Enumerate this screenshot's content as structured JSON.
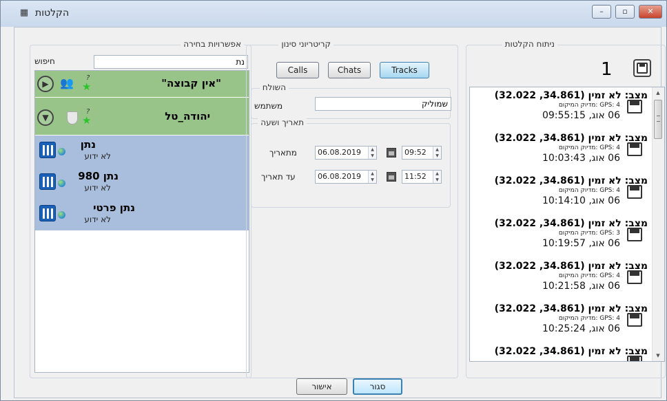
{
  "window": {
    "title": "הקלטות"
  },
  "options_panel": {
    "title": "אפשרויות בחירה",
    "search_label": "חיפוש",
    "search_value": "נת",
    "items": [
      {
        "name": "\"אין קבוצה\"",
        "kind": "group",
        "expand_icon": "play-circle-icon"
      },
      {
        "name": "יהודה_טל",
        "kind": "group",
        "expand_icon": "chevron-down-circle-icon"
      },
      {
        "name": "נתן",
        "status": "לא ידוע",
        "kind": "user"
      },
      {
        "name": "נתן 980",
        "status": "לא ידוע",
        "kind": "user"
      },
      {
        "name": "נתן פרטי",
        "status": "לא ידוע",
        "kind": "user"
      }
    ]
  },
  "filter_panel": {
    "title": "קריטריוני סינון",
    "tabs": [
      {
        "label": "Calls"
      },
      {
        "label": "Chats"
      },
      {
        "label": "Tracks",
        "active": true
      }
    ],
    "sender_section": {
      "title": "השולח",
      "user_label": "משתמש",
      "user_value": "שמוליק"
    },
    "datetime_section": {
      "title": "תאריך ושעה",
      "from_label": "מתאריך",
      "from_date": "06.08.2019",
      "from_time": "09:52",
      "to_label": "עד תאריך",
      "to_date": "06.08.2019",
      "to_time": "11:52"
    }
  },
  "analysis_panel": {
    "title": "ניתוח הקלטות",
    "marker": "1",
    "records": [
      {
        "title": "מצב: לא זמין (34.861, 32.022)",
        "gps": "GPS: 4 :מדיוק המיקום",
        "time": "06 אוג, 09:55:15"
      },
      {
        "title": "מצב: לא זמין (34.861, 32.022)",
        "gps": "GPS: 4 :מדיוק המיקום",
        "time": "06 אוג, 10:03:43"
      },
      {
        "title": "מצב: לא זמין (34.861, 32.022)",
        "gps": "GPS: 4 :מדיוק המיקום",
        "time": "06 אוג, 10:14:10"
      },
      {
        "title": "מצב: לא זמין (34.861, 32.022)",
        "gps": "GPS: 3 :מדיוק המיקום",
        "time": "06 אוג, 10:19:57"
      },
      {
        "title": "מצב: לא זמין (34.861, 32.022)",
        "gps": "GPS: 4 :מדיוק המיקום",
        "time": "06 אוג, 10:21:58"
      },
      {
        "title": "מצב: לא זמין (34.861, 32.022)",
        "gps": "GPS: 4 :מדיוק המיקום",
        "time": "06 אוג, 10:25:24"
      },
      {
        "title": "מצב: לא זמין (34.861, 32.022)",
        "gps": "",
        "time": ""
      }
    ]
  },
  "footer": {
    "ok_label": "אישור",
    "close_label": "סגור"
  },
  "colors": {
    "group_row": "#98c48a",
    "user_row": "#a9bedc",
    "active_tab": "#a6d7f2"
  }
}
